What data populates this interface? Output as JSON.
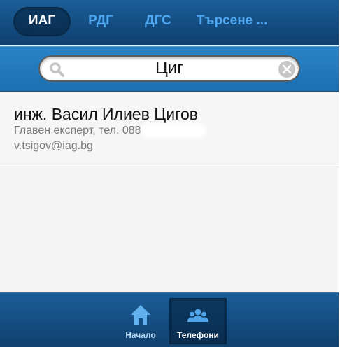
{
  "tabs": [
    {
      "label": "ИАГ",
      "active": true
    },
    {
      "label": "РДГ",
      "active": false
    },
    {
      "label": "ДГС",
      "active": false
    },
    {
      "label": "Търсене ...",
      "active": false
    }
  ],
  "search": {
    "value": "Циг",
    "search_icon": "search-icon",
    "clear_icon": "clear-icon"
  },
  "results": [
    {
      "name": "инж. Васил Илиев Цигов",
      "title_phone": "Главен експерт, тел. 088",
      "email": "v.tsigov@iag.bg"
    }
  ],
  "bottom_nav": [
    {
      "label": "Начало",
      "icon": "home-icon",
      "active": false
    },
    {
      "label": "Телефони",
      "icon": "contacts-icon",
      "active": true
    }
  ],
  "colors": {
    "header": "#1a5e99",
    "search_band": "#2a83c7",
    "tab_inactive_text": "#4fa7f0",
    "active_pill": "#0c3860",
    "list_background": "#f6f6f6"
  }
}
